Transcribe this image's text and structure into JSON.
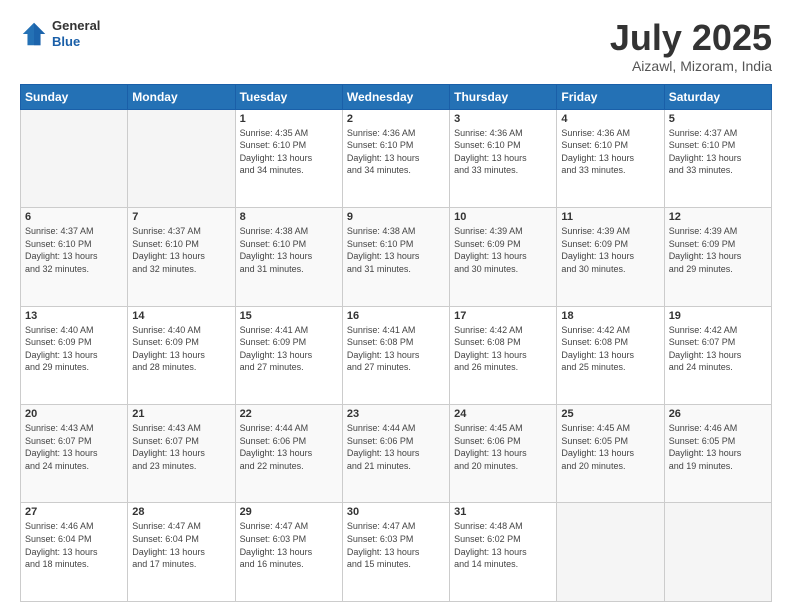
{
  "header": {
    "logo": {
      "general": "General",
      "blue": "Blue"
    },
    "title": "July 2025",
    "subtitle": "Aizawl, Mizoram, India"
  },
  "weekdays": [
    "Sunday",
    "Monday",
    "Tuesday",
    "Wednesday",
    "Thursday",
    "Friday",
    "Saturday"
  ],
  "weeks": [
    [
      {
        "day": "",
        "info": ""
      },
      {
        "day": "",
        "info": ""
      },
      {
        "day": "1",
        "info": "Sunrise: 4:35 AM\nSunset: 6:10 PM\nDaylight: 13 hours\nand 34 minutes."
      },
      {
        "day": "2",
        "info": "Sunrise: 4:36 AM\nSunset: 6:10 PM\nDaylight: 13 hours\nand 34 minutes."
      },
      {
        "day": "3",
        "info": "Sunrise: 4:36 AM\nSunset: 6:10 PM\nDaylight: 13 hours\nand 33 minutes."
      },
      {
        "day": "4",
        "info": "Sunrise: 4:36 AM\nSunset: 6:10 PM\nDaylight: 13 hours\nand 33 minutes."
      },
      {
        "day": "5",
        "info": "Sunrise: 4:37 AM\nSunset: 6:10 PM\nDaylight: 13 hours\nand 33 minutes."
      }
    ],
    [
      {
        "day": "6",
        "info": "Sunrise: 4:37 AM\nSunset: 6:10 PM\nDaylight: 13 hours\nand 32 minutes."
      },
      {
        "day": "7",
        "info": "Sunrise: 4:37 AM\nSunset: 6:10 PM\nDaylight: 13 hours\nand 32 minutes."
      },
      {
        "day": "8",
        "info": "Sunrise: 4:38 AM\nSunset: 6:10 PM\nDaylight: 13 hours\nand 31 minutes."
      },
      {
        "day": "9",
        "info": "Sunrise: 4:38 AM\nSunset: 6:10 PM\nDaylight: 13 hours\nand 31 minutes."
      },
      {
        "day": "10",
        "info": "Sunrise: 4:39 AM\nSunset: 6:09 PM\nDaylight: 13 hours\nand 30 minutes."
      },
      {
        "day": "11",
        "info": "Sunrise: 4:39 AM\nSunset: 6:09 PM\nDaylight: 13 hours\nand 30 minutes."
      },
      {
        "day": "12",
        "info": "Sunrise: 4:39 AM\nSunset: 6:09 PM\nDaylight: 13 hours\nand 29 minutes."
      }
    ],
    [
      {
        "day": "13",
        "info": "Sunrise: 4:40 AM\nSunset: 6:09 PM\nDaylight: 13 hours\nand 29 minutes."
      },
      {
        "day": "14",
        "info": "Sunrise: 4:40 AM\nSunset: 6:09 PM\nDaylight: 13 hours\nand 28 minutes."
      },
      {
        "day": "15",
        "info": "Sunrise: 4:41 AM\nSunset: 6:09 PM\nDaylight: 13 hours\nand 27 minutes."
      },
      {
        "day": "16",
        "info": "Sunrise: 4:41 AM\nSunset: 6:08 PM\nDaylight: 13 hours\nand 27 minutes."
      },
      {
        "day": "17",
        "info": "Sunrise: 4:42 AM\nSunset: 6:08 PM\nDaylight: 13 hours\nand 26 minutes."
      },
      {
        "day": "18",
        "info": "Sunrise: 4:42 AM\nSunset: 6:08 PM\nDaylight: 13 hours\nand 25 minutes."
      },
      {
        "day": "19",
        "info": "Sunrise: 4:42 AM\nSunset: 6:07 PM\nDaylight: 13 hours\nand 24 minutes."
      }
    ],
    [
      {
        "day": "20",
        "info": "Sunrise: 4:43 AM\nSunset: 6:07 PM\nDaylight: 13 hours\nand 24 minutes."
      },
      {
        "day": "21",
        "info": "Sunrise: 4:43 AM\nSunset: 6:07 PM\nDaylight: 13 hours\nand 23 minutes."
      },
      {
        "day": "22",
        "info": "Sunrise: 4:44 AM\nSunset: 6:06 PM\nDaylight: 13 hours\nand 22 minutes."
      },
      {
        "day": "23",
        "info": "Sunrise: 4:44 AM\nSunset: 6:06 PM\nDaylight: 13 hours\nand 21 minutes."
      },
      {
        "day": "24",
        "info": "Sunrise: 4:45 AM\nSunset: 6:06 PM\nDaylight: 13 hours\nand 20 minutes."
      },
      {
        "day": "25",
        "info": "Sunrise: 4:45 AM\nSunset: 6:05 PM\nDaylight: 13 hours\nand 20 minutes."
      },
      {
        "day": "26",
        "info": "Sunrise: 4:46 AM\nSunset: 6:05 PM\nDaylight: 13 hours\nand 19 minutes."
      }
    ],
    [
      {
        "day": "27",
        "info": "Sunrise: 4:46 AM\nSunset: 6:04 PM\nDaylight: 13 hours\nand 18 minutes."
      },
      {
        "day": "28",
        "info": "Sunrise: 4:47 AM\nSunset: 6:04 PM\nDaylight: 13 hours\nand 17 minutes."
      },
      {
        "day": "29",
        "info": "Sunrise: 4:47 AM\nSunset: 6:03 PM\nDaylight: 13 hours\nand 16 minutes."
      },
      {
        "day": "30",
        "info": "Sunrise: 4:47 AM\nSunset: 6:03 PM\nDaylight: 13 hours\nand 15 minutes."
      },
      {
        "day": "31",
        "info": "Sunrise: 4:48 AM\nSunset: 6:02 PM\nDaylight: 13 hours\nand 14 minutes."
      },
      {
        "day": "",
        "info": ""
      },
      {
        "day": "",
        "info": ""
      }
    ]
  ]
}
